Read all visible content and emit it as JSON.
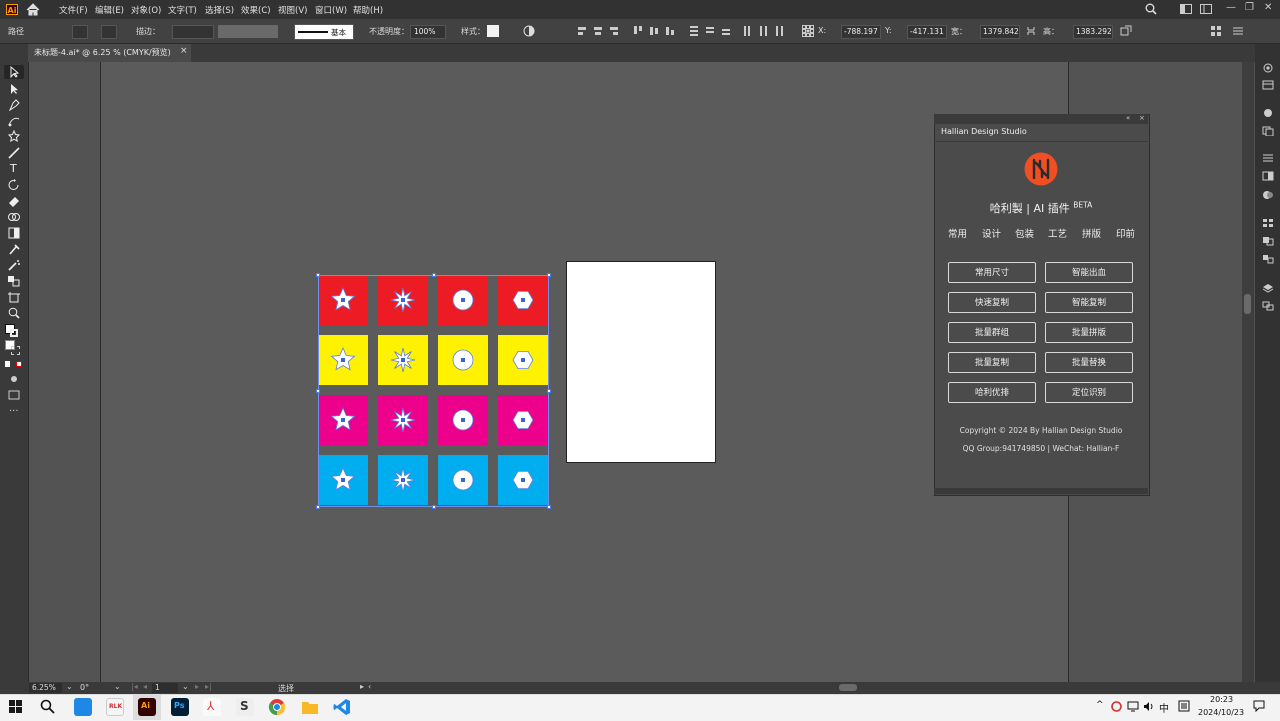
{
  "app": {
    "logo_text": "Ai",
    "menu": [
      "文件(F)",
      "编辑(E)",
      "对象(O)",
      "文字(T)",
      "选择(S)",
      "效果(C)",
      "视图(V)",
      "窗口(W)",
      "帮助(H)"
    ]
  },
  "control_bar": {
    "object_label": "路径",
    "stroke_label": "描边：",
    "brush_label": "基本",
    "opacity_label": "不透明度：",
    "opacity_value": "100%",
    "style_label": "样式：",
    "x_label": "X:",
    "x_value": "-788.197",
    "y_label": "Y:",
    "y_value": "-417.131",
    "w_label": "宽：",
    "w_value": "1379.842",
    "h_label": "高：",
    "h_value": "1383.292"
  },
  "document": {
    "tab_title": "未标题-4.ai* @ 6.25 % (CMYK/预览)",
    "close_glyph": "×"
  },
  "tiles": {
    "rows": [
      {
        "color": "#ed1c24",
        "shapes": [
          "star",
          "burst",
          "circle",
          "hexagon"
        ]
      },
      {
        "color": "#fff200",
        "shapes": [
          "star",
          "burst",
          "circle",
          "hexagon"
        ]
      },
      {
        "color": "#ec008c",
        "shapes": [
          "star",
          "burst",
          "circle",
          "hexagon"
        ]
      },
      {
        "color": "#00aeef",
        "shapes": [
          "star",
          "burst",
          "circle",
          "hexagon"
        ]
      }
    ]
  },
  "plugin": {
    "tab": "Hallian Design Studio",
    "logo_color": "#f04e23",
    "title": "哈利製 | AI 插件",
    "title_badge": "BETA",
    "tabs": [
      "常用",
      "设计",
      "包装",
      "工艺",
      "拼版",
      "印前"
    ],
    "buttons": [
      "常用尺寸",
      "智能出血",
      "快速复制",
      "智能复制",
      "批量群组",
      "批量拼版",
      "批量复制",
      "批量替换",
      "哈利优排",
      "定位识别"
    ],
    "copyright": "Copyright © 2024 By Hallian Design Studio",
    "contact": "QQ Group:941749850 | WeChat: Hallian-F"
  },
  "status_bar": {
    "zoom": "6.25%",
    "rotation": "0°",
    "artboard_num": "1",
    "tool_name": "选择"
  },
  "taskbar": {
    "time": "20:23",
    "date": "2024/10/23",
    "ime": "中",
    "tray_chevron": "^"
  }
}
